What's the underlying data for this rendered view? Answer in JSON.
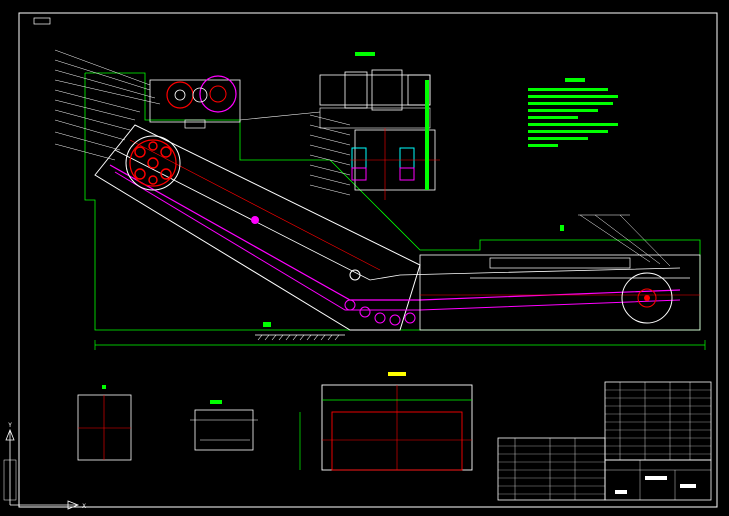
{
  "colors": {
    "background": "#000000",
    "frame": "#ffffff",
    "outline": "#00ff00",
    "chain": "#ff00ff",
    "centerline": "#ff0000",
    "accent": "#ffff00",
    "notes": "#00ff00",
    "parts": "#00ffff",
    "tables": "#ffffff"
  },
  "drawing": {
    "title_block_label": "",
    "notes_heading": "",
    "section_label": ""
  },
  "ucs": {
    "x_axis": "X",
    "y_axis": "Y"
  }
}
